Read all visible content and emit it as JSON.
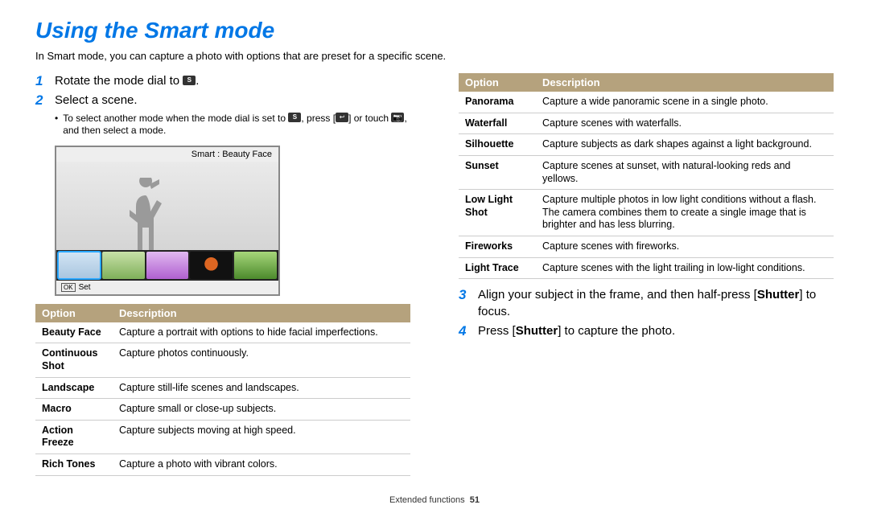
{
  "title": "Using the Smart mode",
  "intro": "In Smart mode, you can capture a photo with options that are preset for a specific scene.",
  "steps": {
    "s1": "Rotate the mode dial to",
    "s1_tail": ".",
    "s2": "Select a scene.",
    "s2_bullet_a": "To select another mode when the mode dial is set to",
    "s2_bullet_b": ", press [",
    "s2_bullet_c": "] or touch",
    "s2_bullet_d": ", and then select a mode.",
    "s3_a": "Align your subject in the frame, and then half-press [",
    "s3_bold": "Shutter",
    "s3_b": "] to focus.",
    "s4_a": "Press [",
    "s4_bold": "Shutter",
    "s4_b": "] to capture the photo."
  },
  "icon_s_label": "S",
  "lcd": {
    "title": "Smart : Beauty Face",
    "ok": "OK",
    "set": "Set"
  },
  "table_headers": {
    "option": "Option",
    "description": "Description"
  },
  "table_left": [
    {
      "opt": "Beauty Face",
      "desc": "Capture a portrait with options to hide facial imperfections."
    },
    {
      "opt": "Continuous Shot",
      "desc": "Capture photos continuously."
    },
    {
      "opt": "Landscape",
      "desc": "Capture still-life scenes and landscapes."
    },
    {
      "opt": "Macro",
      "desc": "Capture small or close-up subjects."
    },
    {
      "opt": "Action Freeze",
      "desc": "Capture subjects moving at high speed."
    },
    {
      "opt": "Rich Tones",
      "desc": "Capture a photo with vibrant colors."
    }
  ],
  "table_right": [
    {
      "opt": "Panorama",
      "desc": "Capture a wide panoramic scene in a single photo."
    },
    {
      "opt": "Waterfall",
      "desc": "Capture scenes with waterfalls."
    },
    {
      "opt": "Silhouette",
      "desc": "Capture subjects as dark shapes against a light background."
    },
    {
      "opt": "Sunset",
      "desc": "Capture scenes at sunset, with natural-looking reds and yellows."
    },
    {
      "opt": "Low Light Shot",
      "desc": "Capture multiple photos in low light conditions without a flash. The camera combines them to create a single image that is brighter and has less blurring."
    },
    {
      "opt": "Fireworks",
      "desc": "Capture scenes with fireworks."
    },
    {
      "opt": "Light Trace",
      "desc": "Capture scenes with the light trailing in low-light conditions."
    }
  ],
  "footer": {
    "section": "Extended functions",
    "page": "51"
  }
}
